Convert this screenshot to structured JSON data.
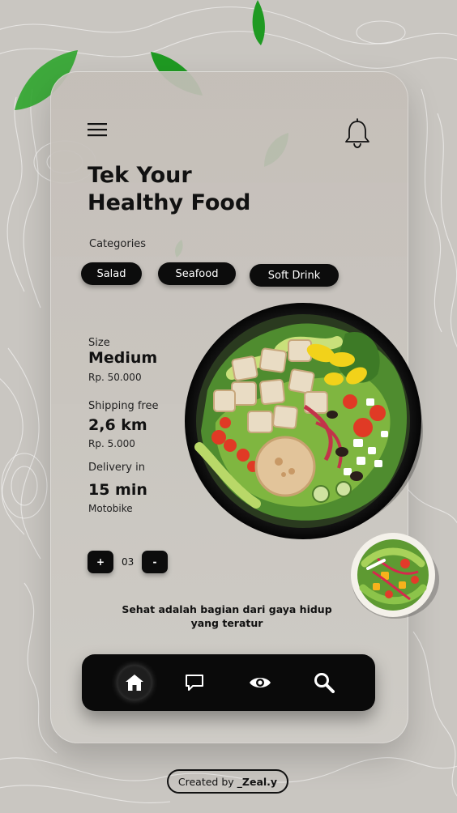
{
  "header": {
    "menu_icon": "hamburger-menu-icon",
    "notification_icon": "bell-icon",
    "title_line1": "Tek Your",
    "title_line2": "Healthy Food"
  },
  "categories": {
    "label": "Categories",
    "items": [
      "Salad",
      "Seafood",
      "Soft Drink"
    ]
  },
  "details": {
    "size": {
      "label": "Size",
      "value": "Medium",
      "price": "Rp. 50.000"
    },
    "shipping": {
      "label": "Shipping free",
      "value": "2,6 km",
      "price": "Rp. 5.000"
    },
    "delivery": {
      "label": "Delivery in",
      "value": "15 min",
      "method": "Motobike"
    }
  },
  "quantity": {
    "plus_label": "+",
    "value": "03",
    "minus_label": "-"
  },
  "motto": {
    "line1": "Sehat adalah bagian dari gaya hidup",
    "line2": "yang teratur"
  },
  "bottom_nav": {
    "items": [
      "home-icon",
      "chat-icon",
      "eye-icon",
      "search-icon"
    ],
    "active": "home-icon"
  },
  "credit": {
    "prefix": "Created by",
    "author": "_Zeal.y"
  },
  "colors": {
    "accent": "#0c0c0c",
    "leaf": "#2fa02f",
    "background": "#c9c6c1"
  }
}
